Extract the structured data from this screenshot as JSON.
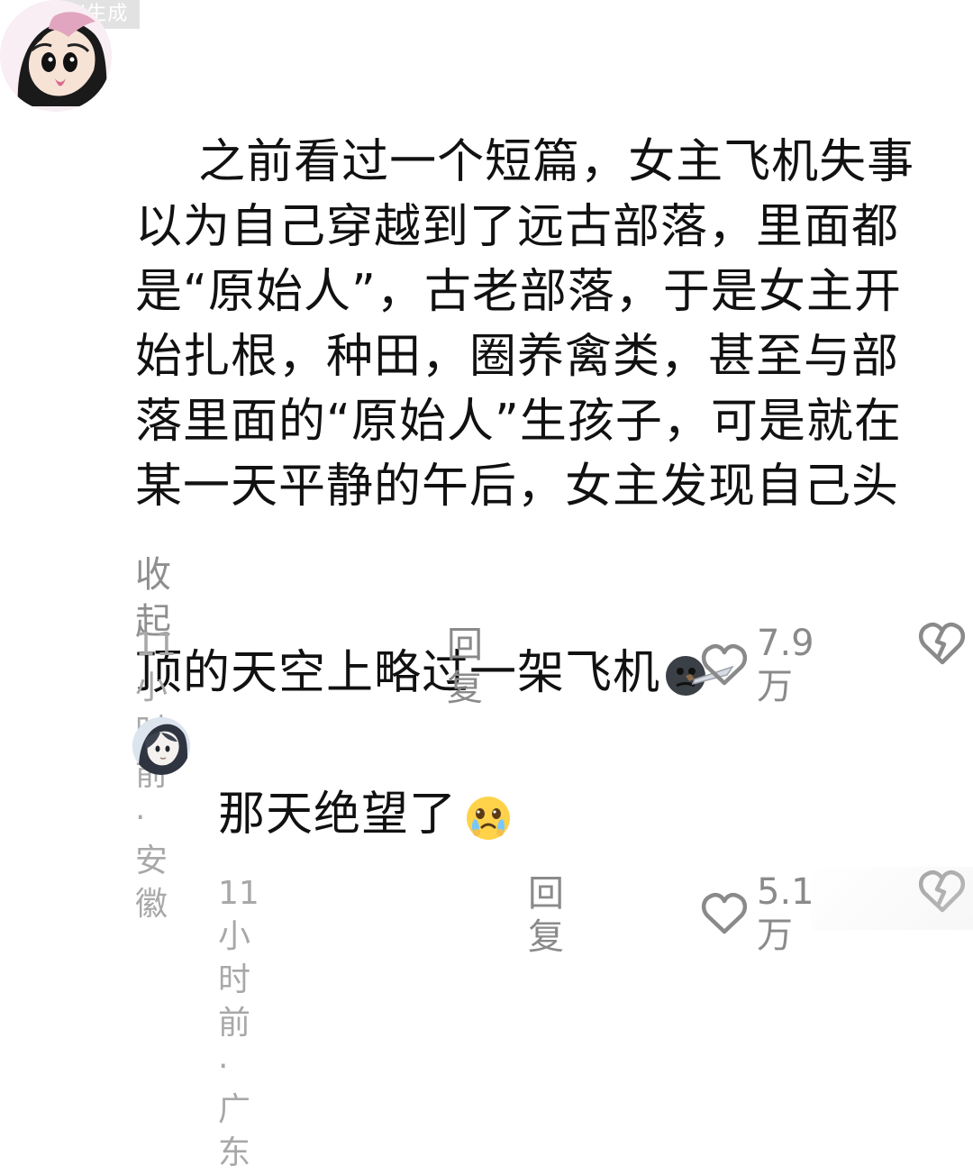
{
  "watermark": {
    "label": "AI生成"
  },
  "comment_1": {
    "text": "之前看过一个短篇，女主飞机失事以为自己穿越到了远古部落，里面都是“原始人”，古老部落，于是女主开始扎根，种田，圈养禽类，甚至与部落里面的“原始人”生孩子，可是就在某一天平静的午后，女主发现自己头顶的天空上略过一架飞机",
    "collapse_label": "收起",
    "meta": "11小时前 · 安徽",
    "reply_label": "回复",
    "likes": "7.9万"
  },
  "comment_2": {
    "text": "那天绝望了",
    "meta": "11小时前 · 广东",
    "reply_label": "回复",
    "likes": "5.1万"
  },
  "icons": {
    "like": "heart-outline-icon",
    "dislike": "broken-heart-icon",
    "emoji_1": "knife-emoji-icon",
    "emoji_2": "crying-face-icon"
  },
  "colors": {
    "primary_text": "#111111",
    "secondary_text": "#8a8a8a",
    "meta_text": "#a8a8a8",
    "background": "#ffffff"
  }
}
